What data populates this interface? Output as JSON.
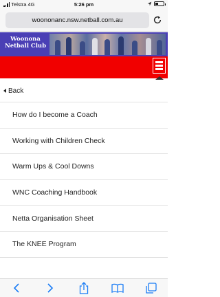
{
  "status_bar": {
    "carrier": "Telstra",
    "network": "4G",
    "time": "5:26 pm",
    "battery_level": 0.35
  },
  "browser": {
    "url": "woononanc.nsw.netball.com.au",
    "reload_icon": "reload-icon"
  },
  "site": {
    "logo_line1": "Woonona",
    "logo_line2": "Netball Club",
    "header_color": "#4a3fb5",
    "accent_color": "#f10000"
  },
  "menu": {
    "back_label": "Back",
    "items": [
      {
        "label": "How do I become a Coach"
      },
      {
        "label": "Working with Children Check"
      },
      {
        "label": "Warm Ups & Cool Downs"
      },
      {
        "label": "WNC Coaching Handbook"
      },
      {
        "label": "Netta Organisation Sheet"
      },
      {
        "label": "The KNEE Program"
      }
    ]
  },
  "toolbar": {
    "icons": [
      "back-icon",
      "forward-icon",
      "share-icon",
      "bookmarks-icon",
      "tabs-icon"
    ],
    "icon_color": "#1a7cf5"
  }
}
